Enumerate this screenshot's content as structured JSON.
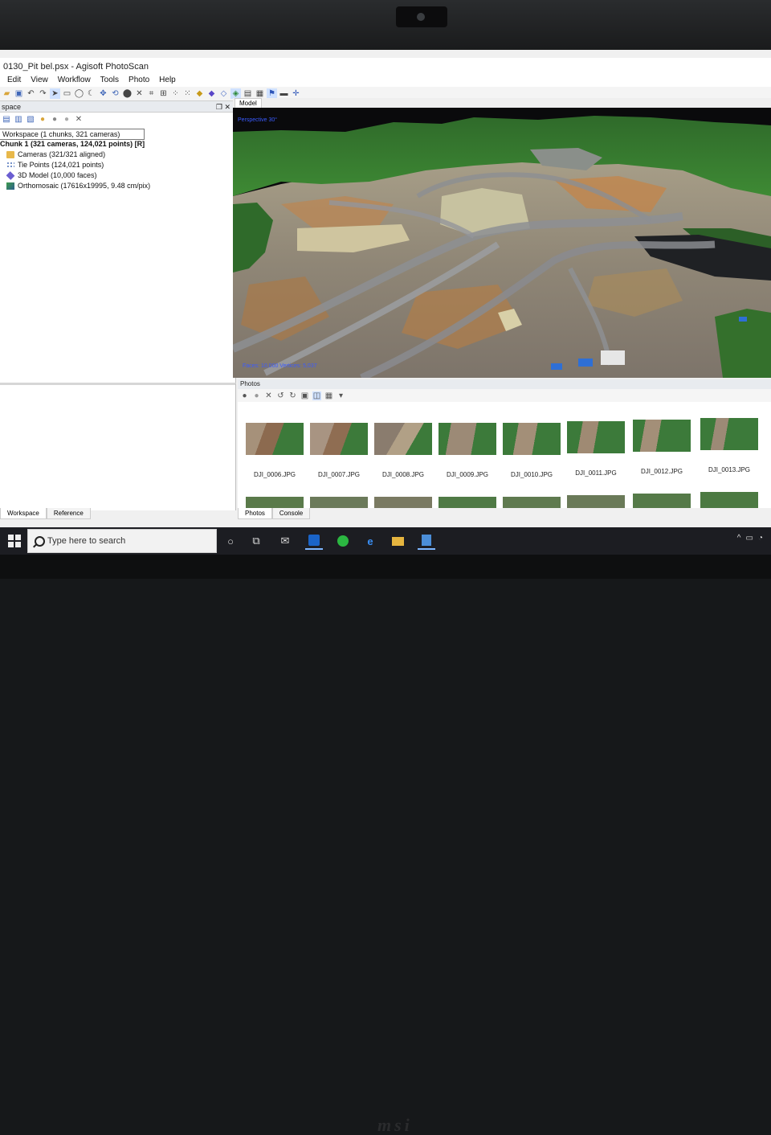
{
  "window": {
    "title": "0130_Pit bel.psx - Agisoft PhotoScan"
  },
  "menu": [
    "Edit",
    "View",
    "Workflow",
    "Tools",
    "Photo",
    "Help"
  ],
  "workspace": {
    "header": "space",
    "root": "Workspace (1 chunks, 321 cameras)",
    "chunk": "Chunk 1 (321 cameras, 124,021 points) [R]",
    "items": [
      {
        "label": "Cameras (321/321 aligned)",
        "icon": "folder-icon",
        "color": "#e8b84a"
      },
      {
        "label": "Tie Points (124,021 points)",
        "icon": "points-icon",
        "color": "#4a6fb8"
      },
      {
        "label": "3D Model (10,000 faces)",
        "icon": "mesh-icon",
        "color": "#6b5ed1"
      },
      {
        "label": "Orthomosaic (17616x19995, 9.48 cm/pix)",
        "icon": "orthomosaic-icon",
        "color": "#3d9b4a"
      }
    ]
  },
  "left_tabs": [
    "Workspace",
    "Reference"
  ],
  "model": {
    "tab": "Model",
    "view_label": "Perspective 30°",
    "stats": "Faces: 10,000 Vertices: 5,037"
  },
  "photos": {
    "header": "Photos",
    "thumbnails": [
      "DJI_0006.JPG",
      "DJI_0007.JPG",
      "DJI_0008.JPG",
      "DJI_0009.JPG",
      "DJI_0010.JPG",
      "DJI_0011.JPG",
      "DJI_0012.JPG",
      "DJI_0013.JPG"
    ]
  },
  "photos_tabs": [
    "Photos",
    "Console"
  ],
  "taskbar": {
    "search_placeholder": "Type here to search"
  },
  "brand": "msi"
}
